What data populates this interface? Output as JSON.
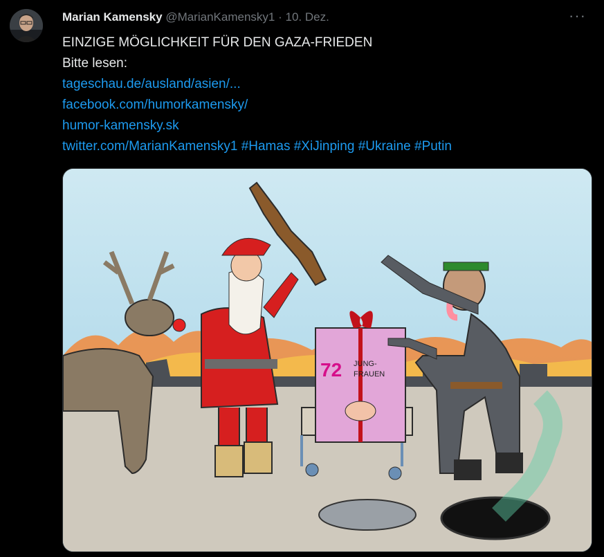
{
  "tweet": {
    "author_name": "Marian Kamensky",
    "author_handle": "@MarianKamensky1",
    "separator": "·",
    "date": "10. Dez.",
    "more": "···",
    "lines": [
      "EINZIGE MÖGLICHKEIT FÜR DEN GAZA-FRIEDEN",
      "Bitte lesen:"
    ],
    "links": [
      "tageschau.de/ausland/asien/...",
      "facebook.com/humorkamensky/",
      "humor-kamensky.sk"
    ],
    "last_line": {
      "link": "twitter.com/MarianKamensky1",
      "hashtags": [
        "#Hamas",
        "#XiJinping",
        "#Ukraine",
        "#Putin"
      ]
    }
  },
  "cartoon": {
    "box_number": "72",
    "box_label_1": "JUNG-",
    "box_label_2": "FRAUEN"
  },
  "colors": {
    "background": "#000000",
    "text": "#e7e9ea",
    "secondary": "#71767b",
    "link": "#1d9bf0"
  }
}
